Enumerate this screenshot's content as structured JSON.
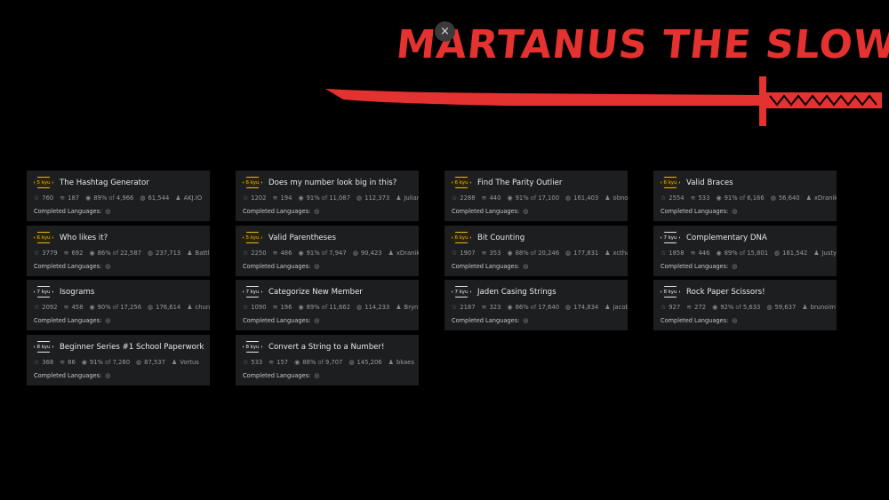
{
  "banner": {
    "title": "MARTANUS THE SLOW",
    "accent": "#e3322f",
    "close_label": "×"
  },
  "langs_label": "Completed Languages:",
  "kata": [
    {
      "rank": "5 kyu",
      "color": "yellow",
      "name": "The Hashtag Generator",
      "stars": "760",
      "collections": "187",
      "satisfaction": "89%",
      "of_word": "of",
      "votes": "4,966",
      "completed": "61,544",
      "author": "AKJ.IO"
    },
    {
      "rank": "6 kyu",
      "color": "yellow",
      "name": "Who likes it?",
      "stars": "3779",
      "collections": "692",
      "satisfaction": "86%",
      "of_word": "of",
      "votes": "22,587",
      "completed": "237,713",
      "author": "Battle"
    },
    {
      "rank": "7 kyu",
      "color": "white",
      "name": "Isograms",
      "stars": "2092",
      "collections": "458",
      "satisfaction": "90%",
      "of_word": "of",
      "votes": "17,256",
      "completed": "176,614",
      "author": "chunj"
    },
    {
      "rank": "8 kyu",
      "color": "white",
      "name": "Beginner Series #1 School Paperwork",
      "stars": "368",
      "collections": "86",
      "satisfaction": "91%",
      "of_word": "of",
      "votes": "7,280",
      "completed": "87,537",
      "author": "Vortus"
    },
    {
      "rank": "6 kyu",
      "color": "yellow",
      "name": "Does my number look big in this?",
      "stars": "1202",
      "collections": "194",
      "satisfaction": "91%",
      "of_word": "of",
      "votes": "11,087",
      "completed": "112,373",
      "author": "Julian"
    },
    {
      "rank": "5 kyu",
      "color": "yellow",
      "name": "Valid Parentheses",
      "stars": "2250",
      "collections": "486",
      "satisfaction": "91%",
      "of_word": "of",
      "votes": "7,947",
      "completed": "90,423",
      "author": "xDranik"
    },
    {
      "rank": "7 kyu",
      "color": "white",
      "name": "Categorize New Member",
      "stars": "1090",
      "collections": "196",
      "satisfaction": "89%",
      "of_word": "of",
      "votes": "11,662",
      "completed": "114,233",
      "author": "Bryn"
    },
    {
      "rank": "8 kyu",
      "color": "white",
      "name": "Convert a String to a Number!",
      "stars": "533",
      "collections": "157",
      "satisfaction": "88%",
      "of_word": "of",
      "votes": "9,707",
      "completed": "145,206",
      "author": "bkaes"
    },
    {
      "rank": "6 kyu",
      "color": "yellow",
      "name": "Find The Parity Outlier",
      "stars": "2288",
      "collections": "440",
      "satisfaction": "91%",
      "of_word": "of",
      "votes": "17,100",
      "completed": "161,403",
      "author": "obnov"
    },
    {
      "rank": "6 kyu",
      "color": "yellow",
      "name": "Bit Counting",
      "stars": "1907",
      "collections": "353",
      "satisfaction": "88%",
      "of_word": "of",
      "votes": "20,246",
      "completed": "177,831",
      "author": "xcthu"
    },
    {
      "rank": "7 kyu",
      "color": "white",
      "name": "Jaden Casing Strings",
      "stars": "2187",
      "collections": "323",
      "satisfaction": "86%",
      "of_word": "of",
      "votes": "17,640",
      "completed": "174,834",
      "author": "jacob"
    },
    {
      "rank": "6 kyu",
      "color": "yellow",
      "name": "Valid Braces",
      "stars": "2554",
      "collections": "533",
      "satisfaction": "91%",
      "of_word": "of",
      "votes": "6,166",
      "completed": "56,640",
      "author": "xDranik"
    },
    {
      "rank": "7 kyu",
      "color": "white",
      "name": "Complementary DNA",
      "stars": "1858",
      "collections": "446",
      "satisfaction": "89%",
      "of_word": "of",
      "votes": "15,801",
      "completed": "161,542",
      "author": "JustyF"
    },
    {
      "rank": "8 kyu",
      "color": "white",
      "name": "Rock Paper Scissors!",
      "stars": "927",
      "collections": "272",
      "satisfaction": "92%",
      "of_word": "of",
      "votes": "5,633",
      "completed": "59,637",
      "author": "brunoim"
    }
  ]
}
